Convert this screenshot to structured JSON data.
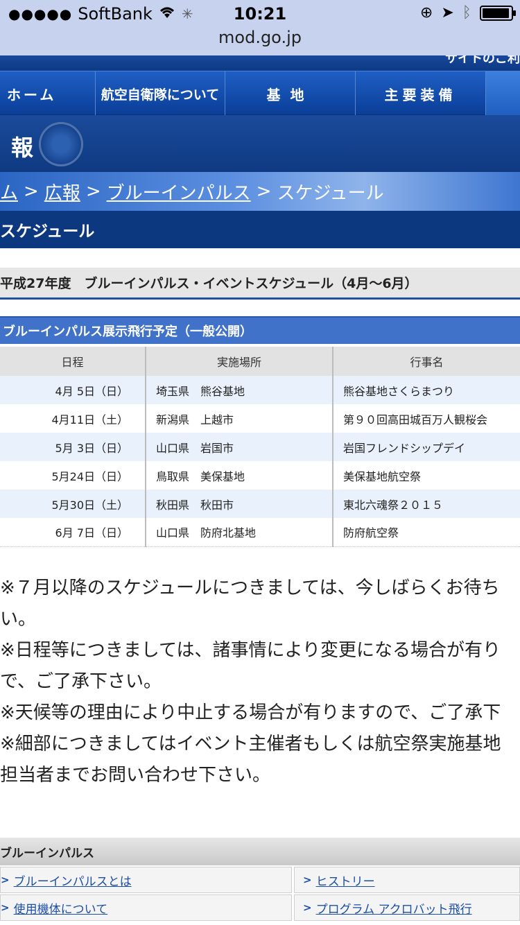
{
  "status": {
    "carrier": "SoftBank",
    "signal": "●●●●●",
    "time": "10:21",
    "url": "mod.go.jp"
  },
  "header": {
    "sitemap_label": "サイトのご利",
    "nav": [
      "ホーム",
      "航空自衛隊について",
      "基地",
      "主要装備",
      ""
    ],
    "section_title": "報"
  },
  "breadcrumb": {
    "items": [
      "ム",
      "広報",
      "ブルーインパルス",
      "スケジュール"
    ],
    "separator": ">"
  },
  "page_title": "スケジュール",
  "section": {
    "title": "平成27年度　ブルーインパルス・イベントスケジュール（4月～6月）",
    "table_title": "ブルーインパルス展示飛行予定（一般公開）",
    "columns": [
      "日程",
      "実施場所",
      "行事名"
    ],
    "rows": [
      [
        "4月 5日（日）",
        "埼玉県　熊谷基地",
        "熊谷基地さくらまつり"
      ],
      [
        "4月11日（土）",
        "新潟県　上越市",
        "第９０回高田城百万人観桜会"
      ],
      [
        "5月 3日（日）",
        "山口県　岩国市",
        "岩国フレンドシップデイ"
      ],
      [
        "5月24日（日）",
        "鳥取県　美保基地",
        "美保基地航空祭"
      ],
      [
        "5月30日（土）",
        "秋田県　秋田市",
        "東北六魂祭２０１５"
      ],
      [
        "6月 7日（日）",
        "山口県　防府北基地",
        "防府航空祭"
      ]
    ]
  },
  "notes": [
    "※７月以降のスケジュールにつきましては、今しばらくお待ち",
    "い。",
    "※日程等につきましては、諸事情により変更になる場合が有り",
    "で、ご了承下さい。",
    "※天候等の理由により中止する場合が有りますので、ご了承下",
    "※細部につきましてはイベント主催者もしくは航空祭実施基地",
    "担当者までお問い合わせ下さい。"
  ],
  "related": {
    "title": "ブルーインパルス",
    "links": [
      [
        "ブルーインパルスとは",
        "ヒストリー"
      ],
      [
        "使用機体について",
        "プログラム アクロバット飛行"
      ]
    ]
  }
}
